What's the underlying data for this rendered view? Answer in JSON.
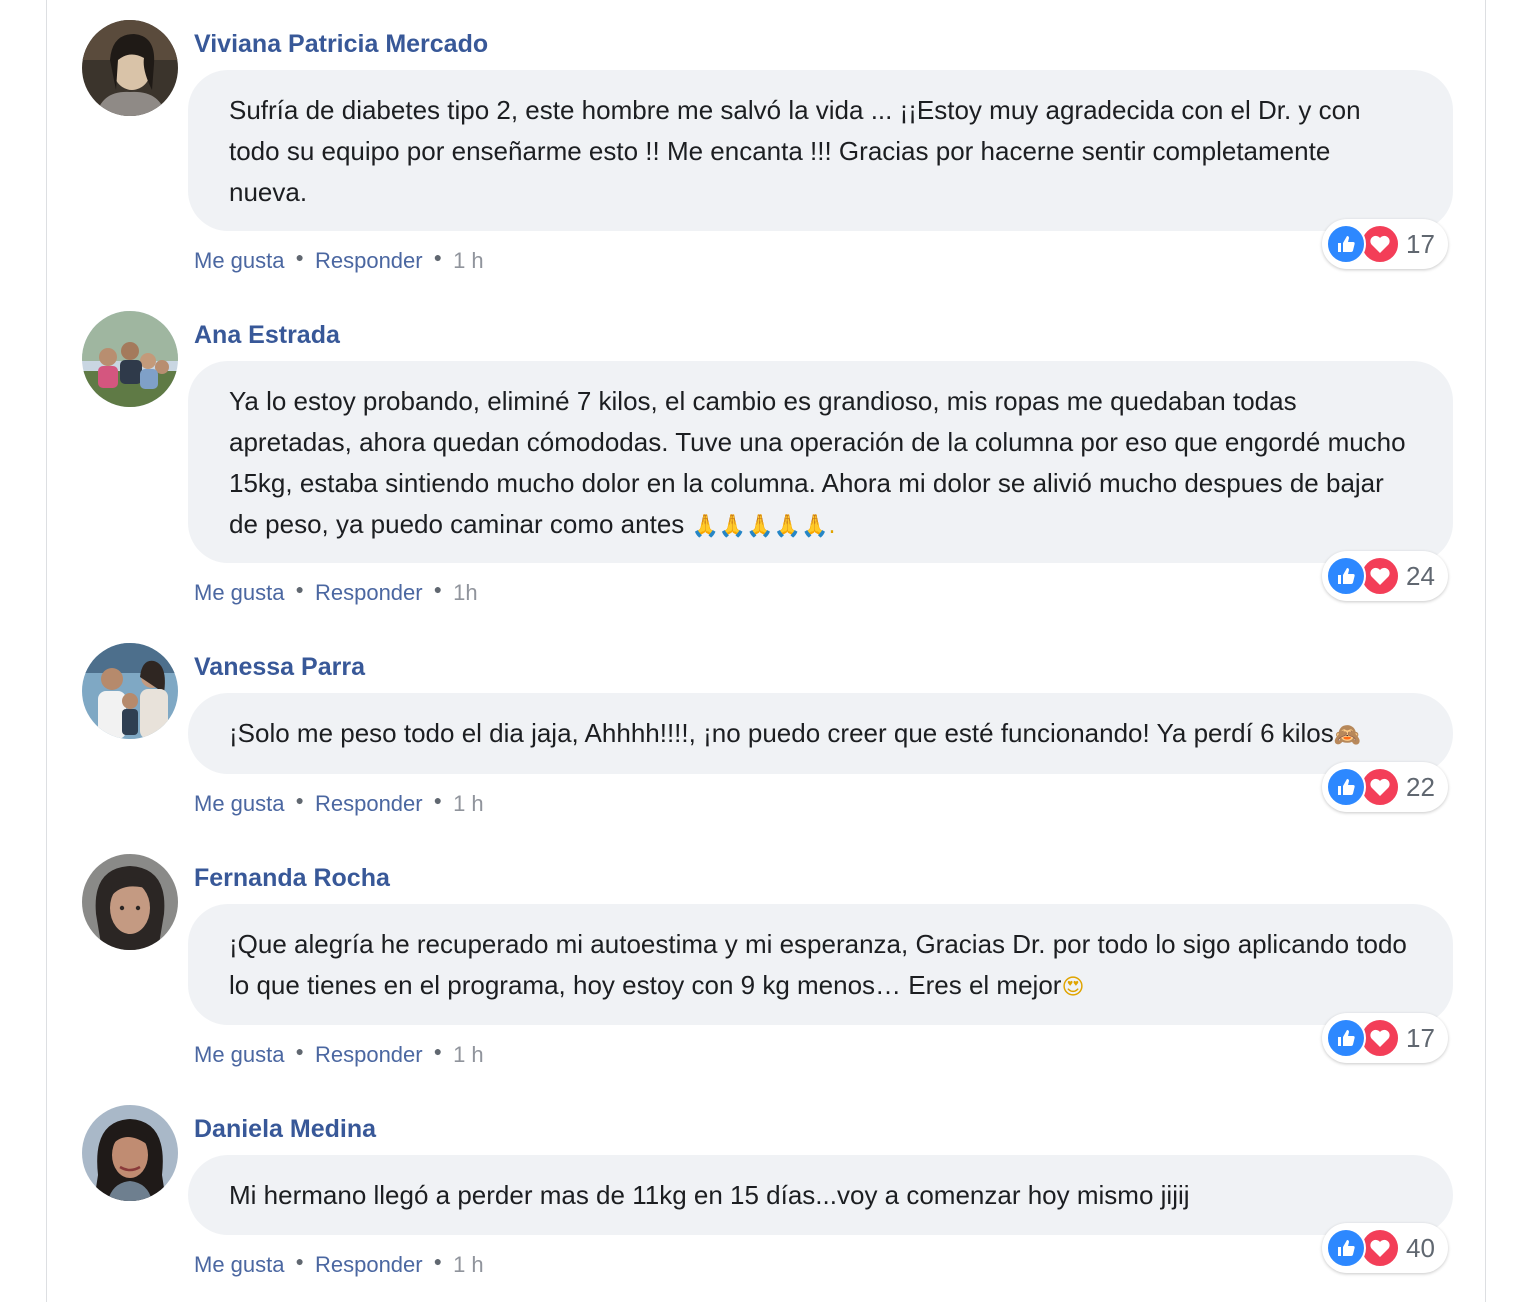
{
  "comments": [
    {
      "author": "Viviana Patricia Mercado",
      "text": "Sufría de diabetes tipo 2, este hombre me salvó la vida ... ¡¡Estoy muy agradecida con el Dr. y con todo su equipo por enseñarme esto !! Me encanta !!! Gracias por hacerne sentir completamente nueva.",
      "emoji": "",
      "like_label": "Me gusta",
      "reply_label": "Responder",
      "time": "1 h",
      "reaction_count": "17",
      "avatar_colors": [
        "#3b342c",
        "#d9c3a8",
        "#6a5a48"
      ]
    },
    {
      "author": "Ana Estrada",
      "text": "Ya lo estoy probando, eliminé 7 kilos, el cambio es grandioso, mis ropas me quedaban todas apretadas, ahora quedan cómododas. Tuve una operación de la columna por eso que engordé mucho 15kg, estaba sintiendo mucho dolor en la columna. Ahora mi dolor se alivió mucho despues de bajar de peso, ya puedo caminar como antes ",
      "emoji": "🙏🙏🙏🙏🙏.",
      "like_label": "Me gusta",
      "reply_label": "Responder",
      "time": "1h",
      "reaction_count": "24",
      "avatar_colors": [
        "#5f7a45",
        "#c9d6e2",
        "#3a4a2f"
      ]
    },
    {
      "author": "Vanessa Parra",
      "text": "¡Solo me peso todo el dia jaja, Ahhhh!!!!, ¡no puedo creer que esté funcionando! Ya perdí 6 kilos",
      "emoji": "🙈",
      "like_label": "Me gusta",
      "reply_label": "Responder",
      "time": "1 h",
      "reaction_count": "22",
      "avatar_colors": [
        "#7fa8c4",
        "#e8e2da",
        "#2f3f52"
      ]
    },
    {
      "author": "Fernanda Rocha",
      "text": "¡Que alegría he recuperado mi autoestima y mi esperanza, Gracias Dr. por todo lo sigo aplicando todo lo que tienes en el programa, hoy estoy con 9 kg menos… Eres el mejor",
      "emoji": "😍",
      "like_label": "Me gusta",
      "reply_label": "Responder",
      "time": "1 h",
      "reaction_count": "17",
      "avatar_colors": [
        "#8a8a88",
        "#c49a82",
        "#2b2624"
      ]
    },
    {
      "author": "Daniela Medina",
      "text": "Mi hermano llegó a perder mas de 11kg en 15 días...voy a comenzar hoy mismo jijij",
      "emoji": "",
      "like_label": "Me gusta",
      "reply_label": "Responder",
      "time": "1 h",
      "reaction_count": "40",
      "avatar_colors": [
        "#a9b8c8",
        "#c08c72",
        "#1f1a18"
      ]
    }
  ],
  "colors": {
    "author_name": "#385898",
    "bubble_bg": "#f0f2f5",
    "like_blue": "#2d88ff",
    "love_red": "#f33e58"
  }
}
